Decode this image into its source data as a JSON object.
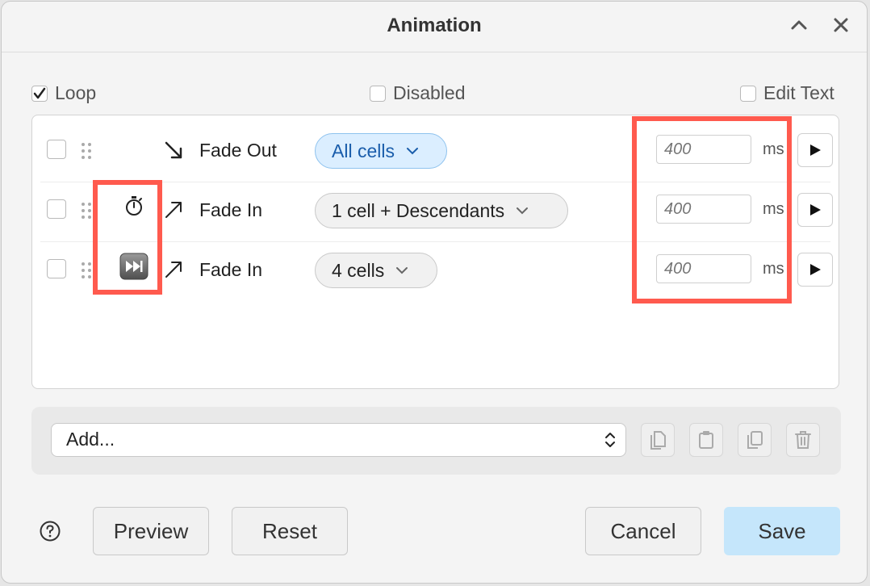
{
  "dialog": {
    "title": "Animation"
  },
  "options": {
    "loop": {
      "label": "Loop",
      "checked": true
    },
    "disabled": {
      "label": "Disabled",
      "checked": false
    },
    "edit_text": {
      "label": "Edit Text",
      "checked": false
    }
  },
  "steps": [
    {
      "effect": "Fade Out",
      "direction_icon": "arrow-down-right-icon",
      "target": "All cells",
      "target_active": true,
      "duration_placeholder": "400",
      "unit": "ms",
      "checked": false,
      "timing_icon": ""
    },
    {
      "effect": "Fade In",
      "direction_icon": "arrow-up-right-icon",
      "target": "1 cell + Descendants",
      "target_active": false,
      "duration_placeholder": "400",
      "unit": "ms",
      "checked": false,
      "timing_icon": "stopwatch-icon"
    },
    {
      "effect": "Fade In",
      "direction_icon": "arrow-up-right-icon",
      "target": "4 cells",
      "target_active": false,
      "duration_placeholder": "400",
      "unit": "ms",
      "checked": false,
      "timing_icon": "fast-forward-icon"
    }
  ],
  "add": {
    "label": "Add..."
  },
  "action_icons": [
    "copy-icon",
    "paste-icon",
    "duplicate-icon",
    "trash-icon"
  ],
  "footer": {
    "preview": "Preview",
    "reset": "Reset",
    "cancel": "Cancel",
    "save": "Save"
  },
  "colors": {
    "highlight": "#ff5a4e",
    "primary": "#c5e6fb",
    "active_chip": "#dbeeff"
  }
}
